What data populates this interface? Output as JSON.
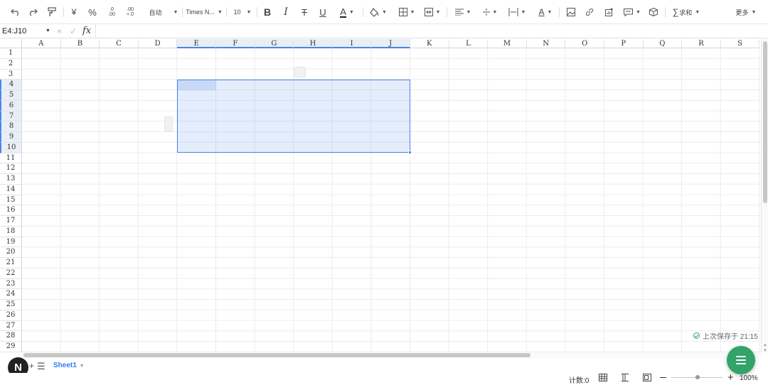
{
  "toolbar": {
    "number_format": "自动",
    "font_name": "Times N...",
    "font_size": "10",
    "sum_label": "求和",
    "more_label": "更多",
    "currency_symbol": "¥",
    "percent_symbol": "%",
    "decrease_decimal": ".0\n.00",
    "increase_decimal": ".00\n+.0",
    "icons": [
      "undo-icon",
      "redo-icon",
      "format-painter-icon",
      "bold-icon",
      "italic-icon",
      "strikethrough-icon",
      "underline-icon",
      "font-color-icon",
      "fill-color-icon",
      "borders-icon",
      "merge-cells-icon",
      "horizontal-align-icon",
      "vertical-align-icon",
      "text-wrap-icon",
      "text-rotate-icon",
      "image-icon",
      "link-icon",
      "chart-icon",
      "comment-icon",
      "cube-icon",
      "sigma-icon"
    ]
  },
  "formula_bar": {
    "name_box": "E4:J10",
    "fx_label": "fx",
    "cancel": "×",
    "confirm": "✓",
    "formula": ""
  },
  "grid": {
    "columns": [
      "A",
      "B",
      "C",
      "D",
      "E",
      "F",
      "G",
      "H",
      "I",
      "J",
      "K",
      "L",
      "M",
      "N",
      "O",
      "P",
      "Q",
      "R",
      "S"
    ],
    "rows": [
      "1",
      "2",
      "3",
      "4",
      "5",
      "6",
      "7",
      "8",
      "9",
      "10",
      "11",
      "12",
      "13",
      "14",
      "15",
      "16",
      "17",
      "18",
      "19",
      "20",
      "21",
      "22",
      "23",
      "24",
      "25",
      "26",
      "27",
      "28",
      "29"
    ],
    "selected_range": "E4:J10",
    "selected_columns": [
      "E",
      "F",
      "G",
      "H",
      "I",
      "J"
    ],
    "selected_rows": [
      "4",
      "5",
      "6",
      "7",
      "8",
      "9",
      "10"
    ]
  },
  "status": {
    "saved_text": "上次保存于 21:15",
    "count_text": "计数:0",
    "zoom_text": "100%"
  },
  "sheets": {
    "active_tab": "Sheet1",
    "add_label": "+",
    "logo": "N"
  },
  "colors": {
    "accent": "#4a86e8",
    "fab": "#33a36a",
    "tab_active": "#2f7bf5"
  }
}
